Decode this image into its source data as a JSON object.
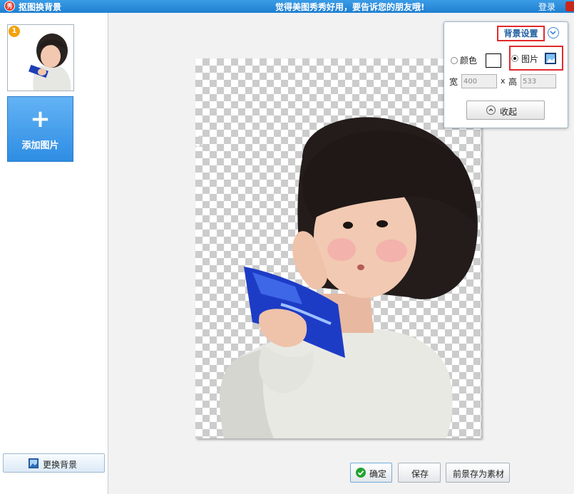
{
  "titlebar": {
    "icon": "xiuxiu-logo-icon",
    "title": "抠图换背景",
    "slogan": "觉得美图秀秀好用，要告诉您的朋友哦!",
    "login": "登录"
  },
  "sidebar": {
    "thumbnail_badge": "1",
    "add_image_label": "添加图片",
    "change_background_label": "更换背景"
  },
  "background_panel": {
    "title": "背景设置",
    "color_option_label": "颜色",
    "image_option_label": "图片",
    "selected_option": "图片",
    "width_label": "宽",
    "width_value": "400",
    "times_label": "x",
    "height_label": "高",
    "height_value": "533",
    "collapse_label": "收起",
    "swatch_color": "#ffffff"
  },
  "toolbar": {
    "confirm_label": "确定",
    "save_label": "保存",
    "save_foreground_label": "前景存为素材"
  },
  "colors": {
    "titlebar": "#2589d8",
    "accent": "#2e8de3",
    "highlight": "#e2292b",
    "panel_title": "#1f5f9f"
  }
}
